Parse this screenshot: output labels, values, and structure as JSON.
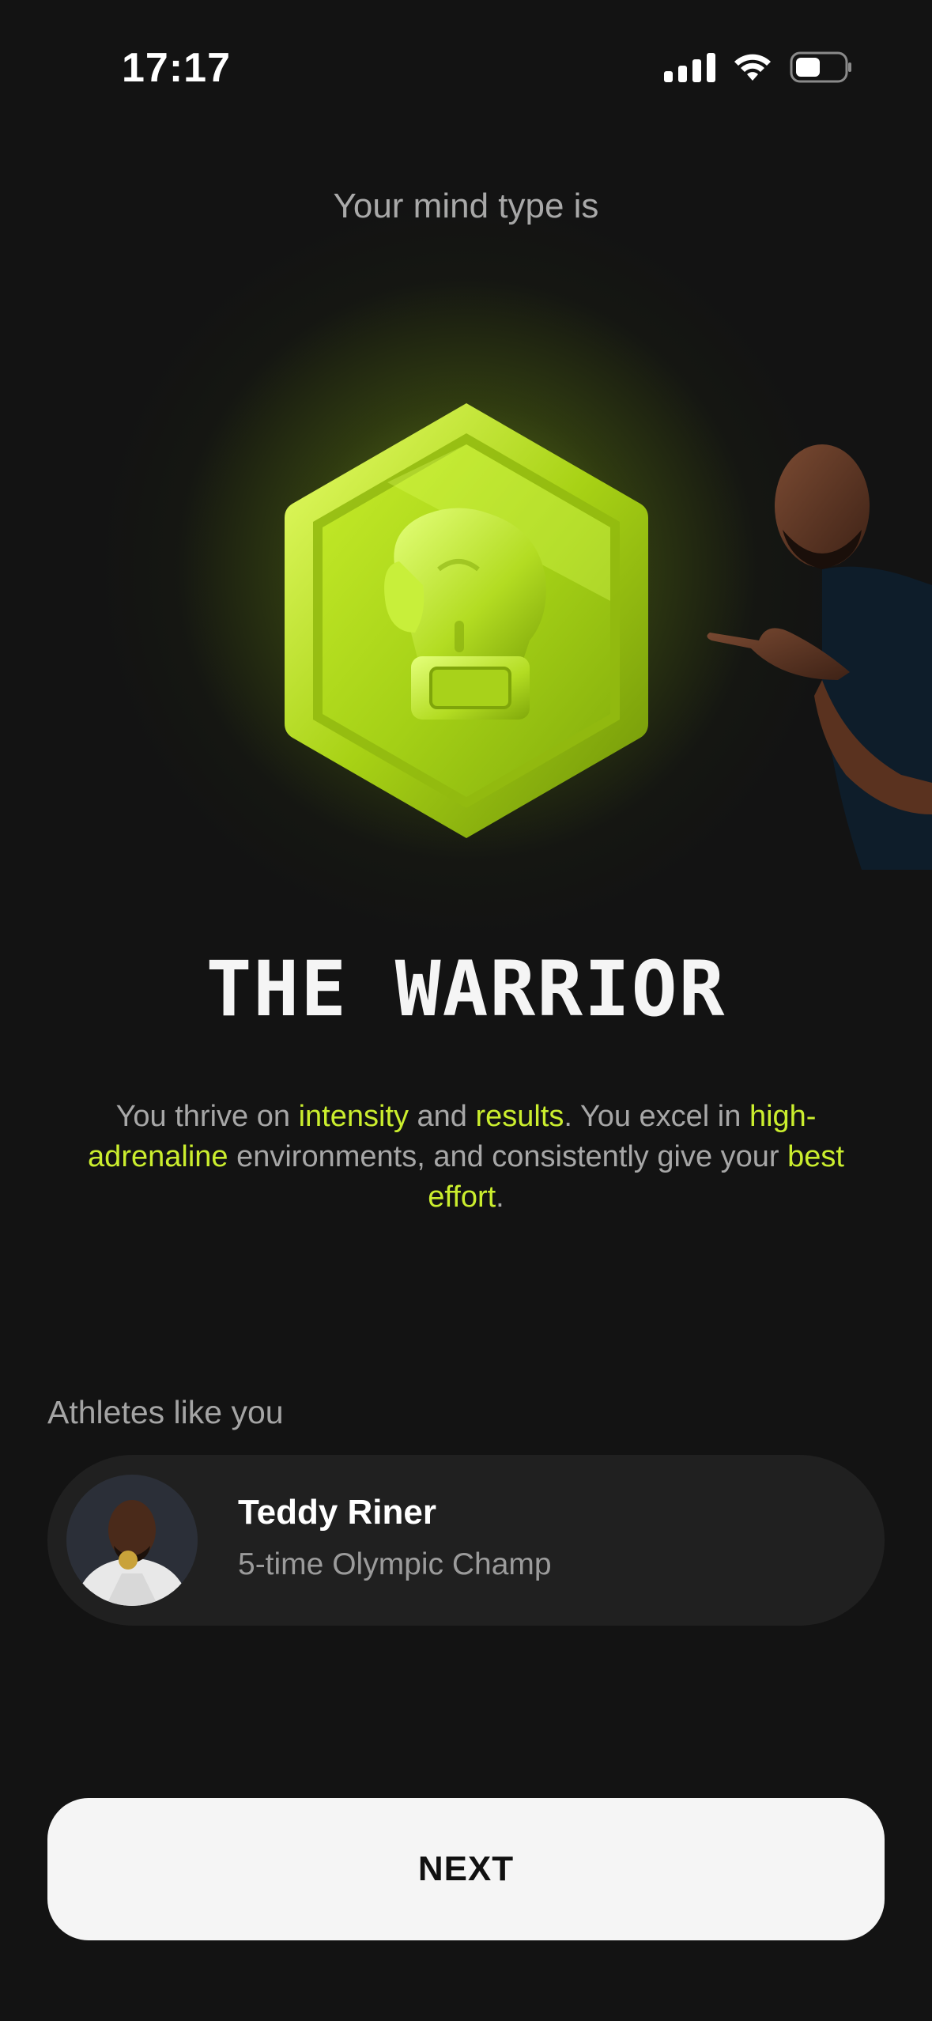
{
  "status_bar": {
    "time": "17:17",
    "icons": [
      "cellular-signal-icon",
      "wifi-icon",
      "battery-icon"
    ]
  },
  "result": {
    "subtitle": "Your mind type is",
    "badge_icon": "boxing-glove-hexagon-badge",
    "title": "THE WARRIOR",
    "description": {
      "part1": "You thrive on ",
      "hl1": "intensity",
      "part2": " and ",
      "hl2": "results",
      "part3": ". You excel in ",
      "hl3": "high-adrenaline",
      "part4": " environments, and consistently give your ",
      "hl4": "best effort",
      "part5": "."
    }
  },
  "athletes": {
    "label": "Athletes like you",
    "items": [
      {
        "name": "Teddy Riner",
        "description": "5-time Olympic Champ"
      }
    ]
  },
  "next_button": {
    "label": "NEXT"
  },
  "colors": {
    "background": "#131313",
    "accent": "#cbee2e",
    "button_bg": "#f5f5f5",
    "card_bg": "#202020"
  }
}
